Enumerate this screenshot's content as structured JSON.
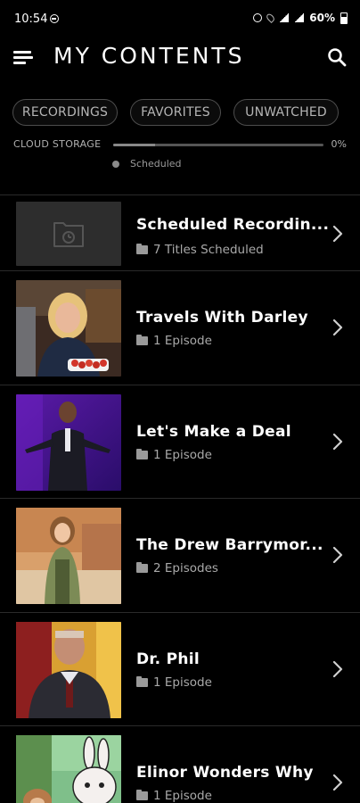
{
  "status_bar": {
    "time": "10:54",
    "battery": "60%"
  },
  "header": {
    "title": "MY CONTENTS"
  },
  "filters": [
    "RECORDINGS",
    "FAVORITES",
    "UNWATCHED"
  ],
  "storage": {
    "label": "CLOUD STORAGE",
    "percent_text": "0%",
    "fill_fraction": 0.2,
    "legend": "Scheduled"
  },
  "items": [
    {
      "title": "Scheduled Recordin...",
      "subtitle": "7 Titles Scheduled",
      "thumb_icon": "folder-clock-icon"
    },
    {
      "title": "Travels With Darley",
      "subtitle": "1 Episode"
    },
    {
      "title": "Let's Make a Deal",
      "subtitle": "1 Episode"
    },
    {
      "title": "The Drew Barrymor...",
      "subtitle": "2 Episodes"
    },
    {
      "title": "Dr. Phil",
      "subtitle": "1 Episode"
    },
    {
      "title": "Elinor Wonders Why",
      "subtitle": "1 Episode"
    }
  ],
  "colors": {
    "background": "#000000",
    "chip_border": "#4d4d4d",
    "text_secondary": "#a9a9a9"
  }
}
